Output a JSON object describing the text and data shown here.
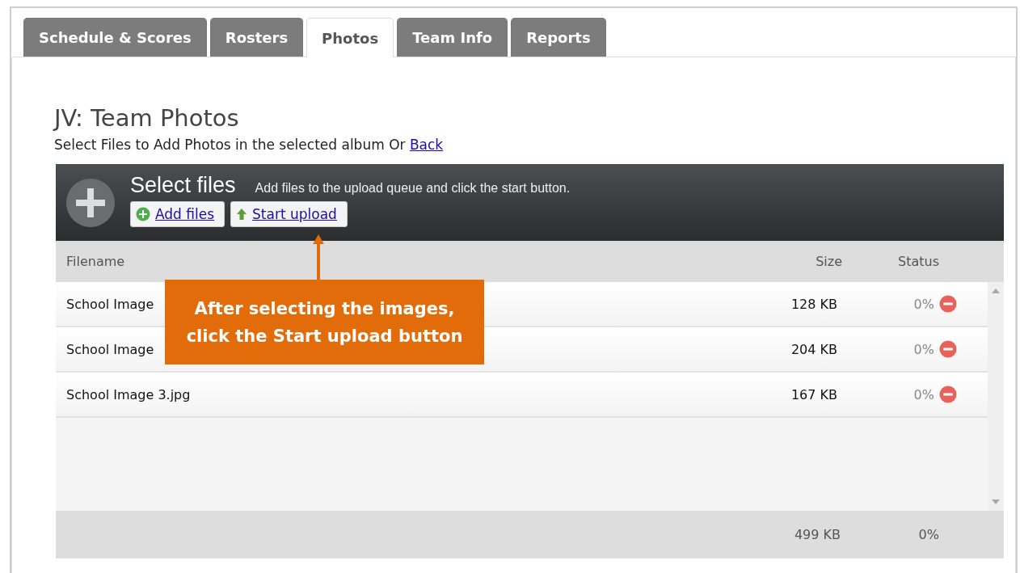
{
  "tabs": [
    {
      "label": "Schedule & Scores",
      "selected": false
    },
    {
      "label": "Rosters",
      "selected": false
    },
    {
      "label": "Photos",
      "selected": true
    },
    {
      "label": "Team Info",
      "selected": false
    },
    {
      "label": "Reports",
      "selected": false
    }
  ],
  "heading": "JV: Team Photos",
  "intro": {
    "text": "Select Files to Add Photos in the selected album Or",
    "link": "Back"
  },
  "uploader": {
    "title": "Select files",
    "hint": "Add files to the upload queue and click the start button.",
    "buttons": [
      {
        "label": "Add files",
        "kind": "add"
      },
      {
        "label": "Start upload",
        "kind": "start"
      }
    ],
    "columns": [
      "Filename",
      "Size",
      "Status"
    ],
    "rows": [
      {
        "filename": "School Image",
        "size": "128 KB",
        "status": "0%"
      },
      {
        "filename": "School Image",
        "size": "204 KB",
        "status": "0%"
      },
      {
        "filename": "School Image 3.jpg",
        "size": "167 KB",
        "status": "0%"
      }
    ],
    "footer": {
      "size": "499 KB",
      "status": "0%"
    }
  },
  "callout": {
    "lines": [
      "After selecting the images,",
      "click the Start upload button"
    ]
  }
}
